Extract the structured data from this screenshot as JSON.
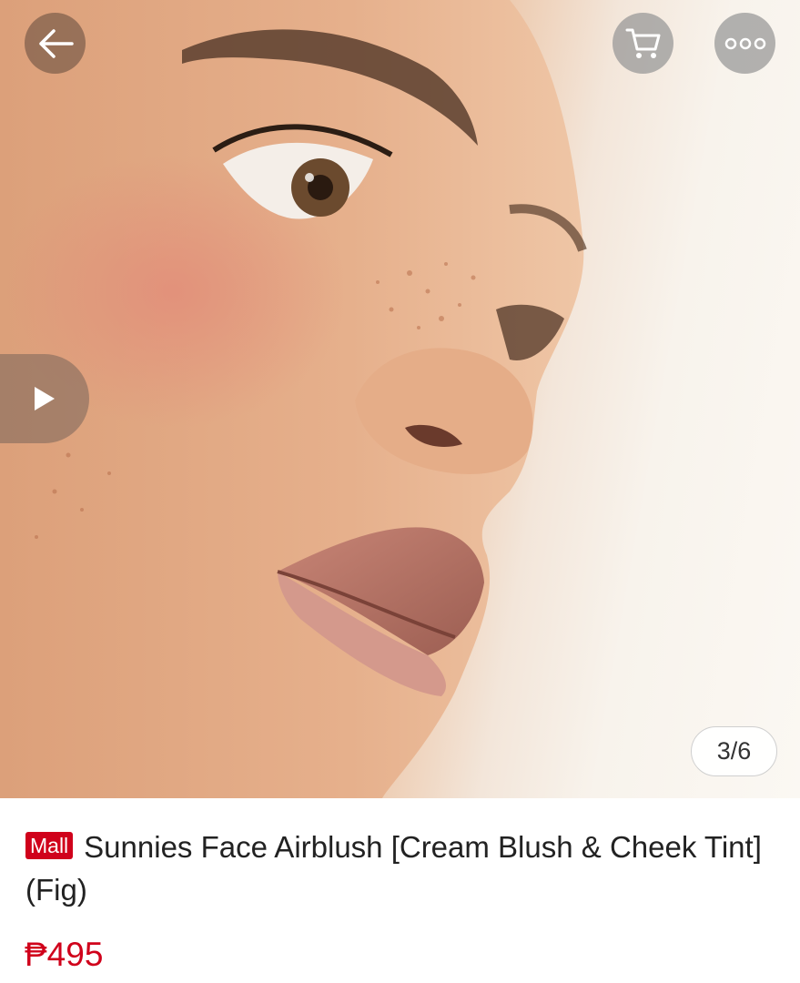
{
  "navigation": {
    "back_icon": "arrow-left-icon",
    "cart_icon": "shopping-cart-icon",
    "more_icon": "more-horizontal-icon"
  },
  "gallery": {
    "play_icon": "play-icon",
    "current_image": 3,
    "total_images": 6,
    "indicator_text": "3/6"
  },
  "product": {
    "badge": "Mall",
    "title": "Sunnies Face Airblush [Cream Blush & Cheek Tint] (Fig)",
    "price": "₱495"
  },
  "colors": {
    "brand_red": "#d0011b",
    "overlay_gray": "#969696"
  }
}
